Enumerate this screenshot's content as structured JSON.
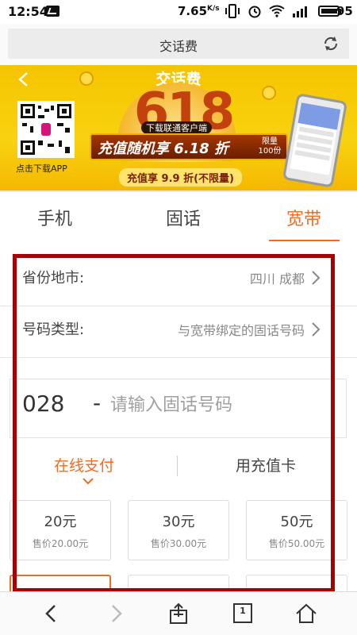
{
  "status_bar": {
    "time": "12:54",
    "network_speed": "7.65",
    "speed_unit": "K/s",
    "battery": "95"
  },
  "url_bar": {
    "title": "交话费"
  },
  "banner": {
    "header_title": "交话费",
    "big_text": "618",
    "ribbon_top": "下载联通客户端",
    "promo_text": "充值随机享 6.18 折",
    "limit_text": "限量100份",
    "subtitle": "充值享 9.9 折(不限量)",
    "qr_caption": "点击下载APP"
  },
  "tabs": {
    "items": [
      "手机",
      "固话",
      "宽带"
    ],
    "active": "宽带"
  },
  "form": {
    "region_label": "省份地市:",
    "region_value": "四川 成都",
    "number_type_label": "号码类型:",
    "number_type_value": "与宽带绑定的固话号码",
    "area_code": "028",
    "dash": "-",
    "phone_placeholder": "请输入固话号码"
  },
  "payment_tabs": {
    "online": "在线支付",
    "card": "用充值卡",
    "active": "在线支付"
  },
  "amount_cards": [
    {
      "amount": "20元",
      "price": "售价20.00元"
    },
    {
      "amount": "30元",
      "price": "售价30.00元"
    },
    {
      "amount": "50元",
      "price": "售价50.00元"
    }
  ],
  "bottom_nav": {
    "tab_count": "1"
  },
  "colors": {
    "accent": "#f26b21",
    "highlight_border": "#a80000",
    "banner_yellow": "#f6c400"
  }
}
